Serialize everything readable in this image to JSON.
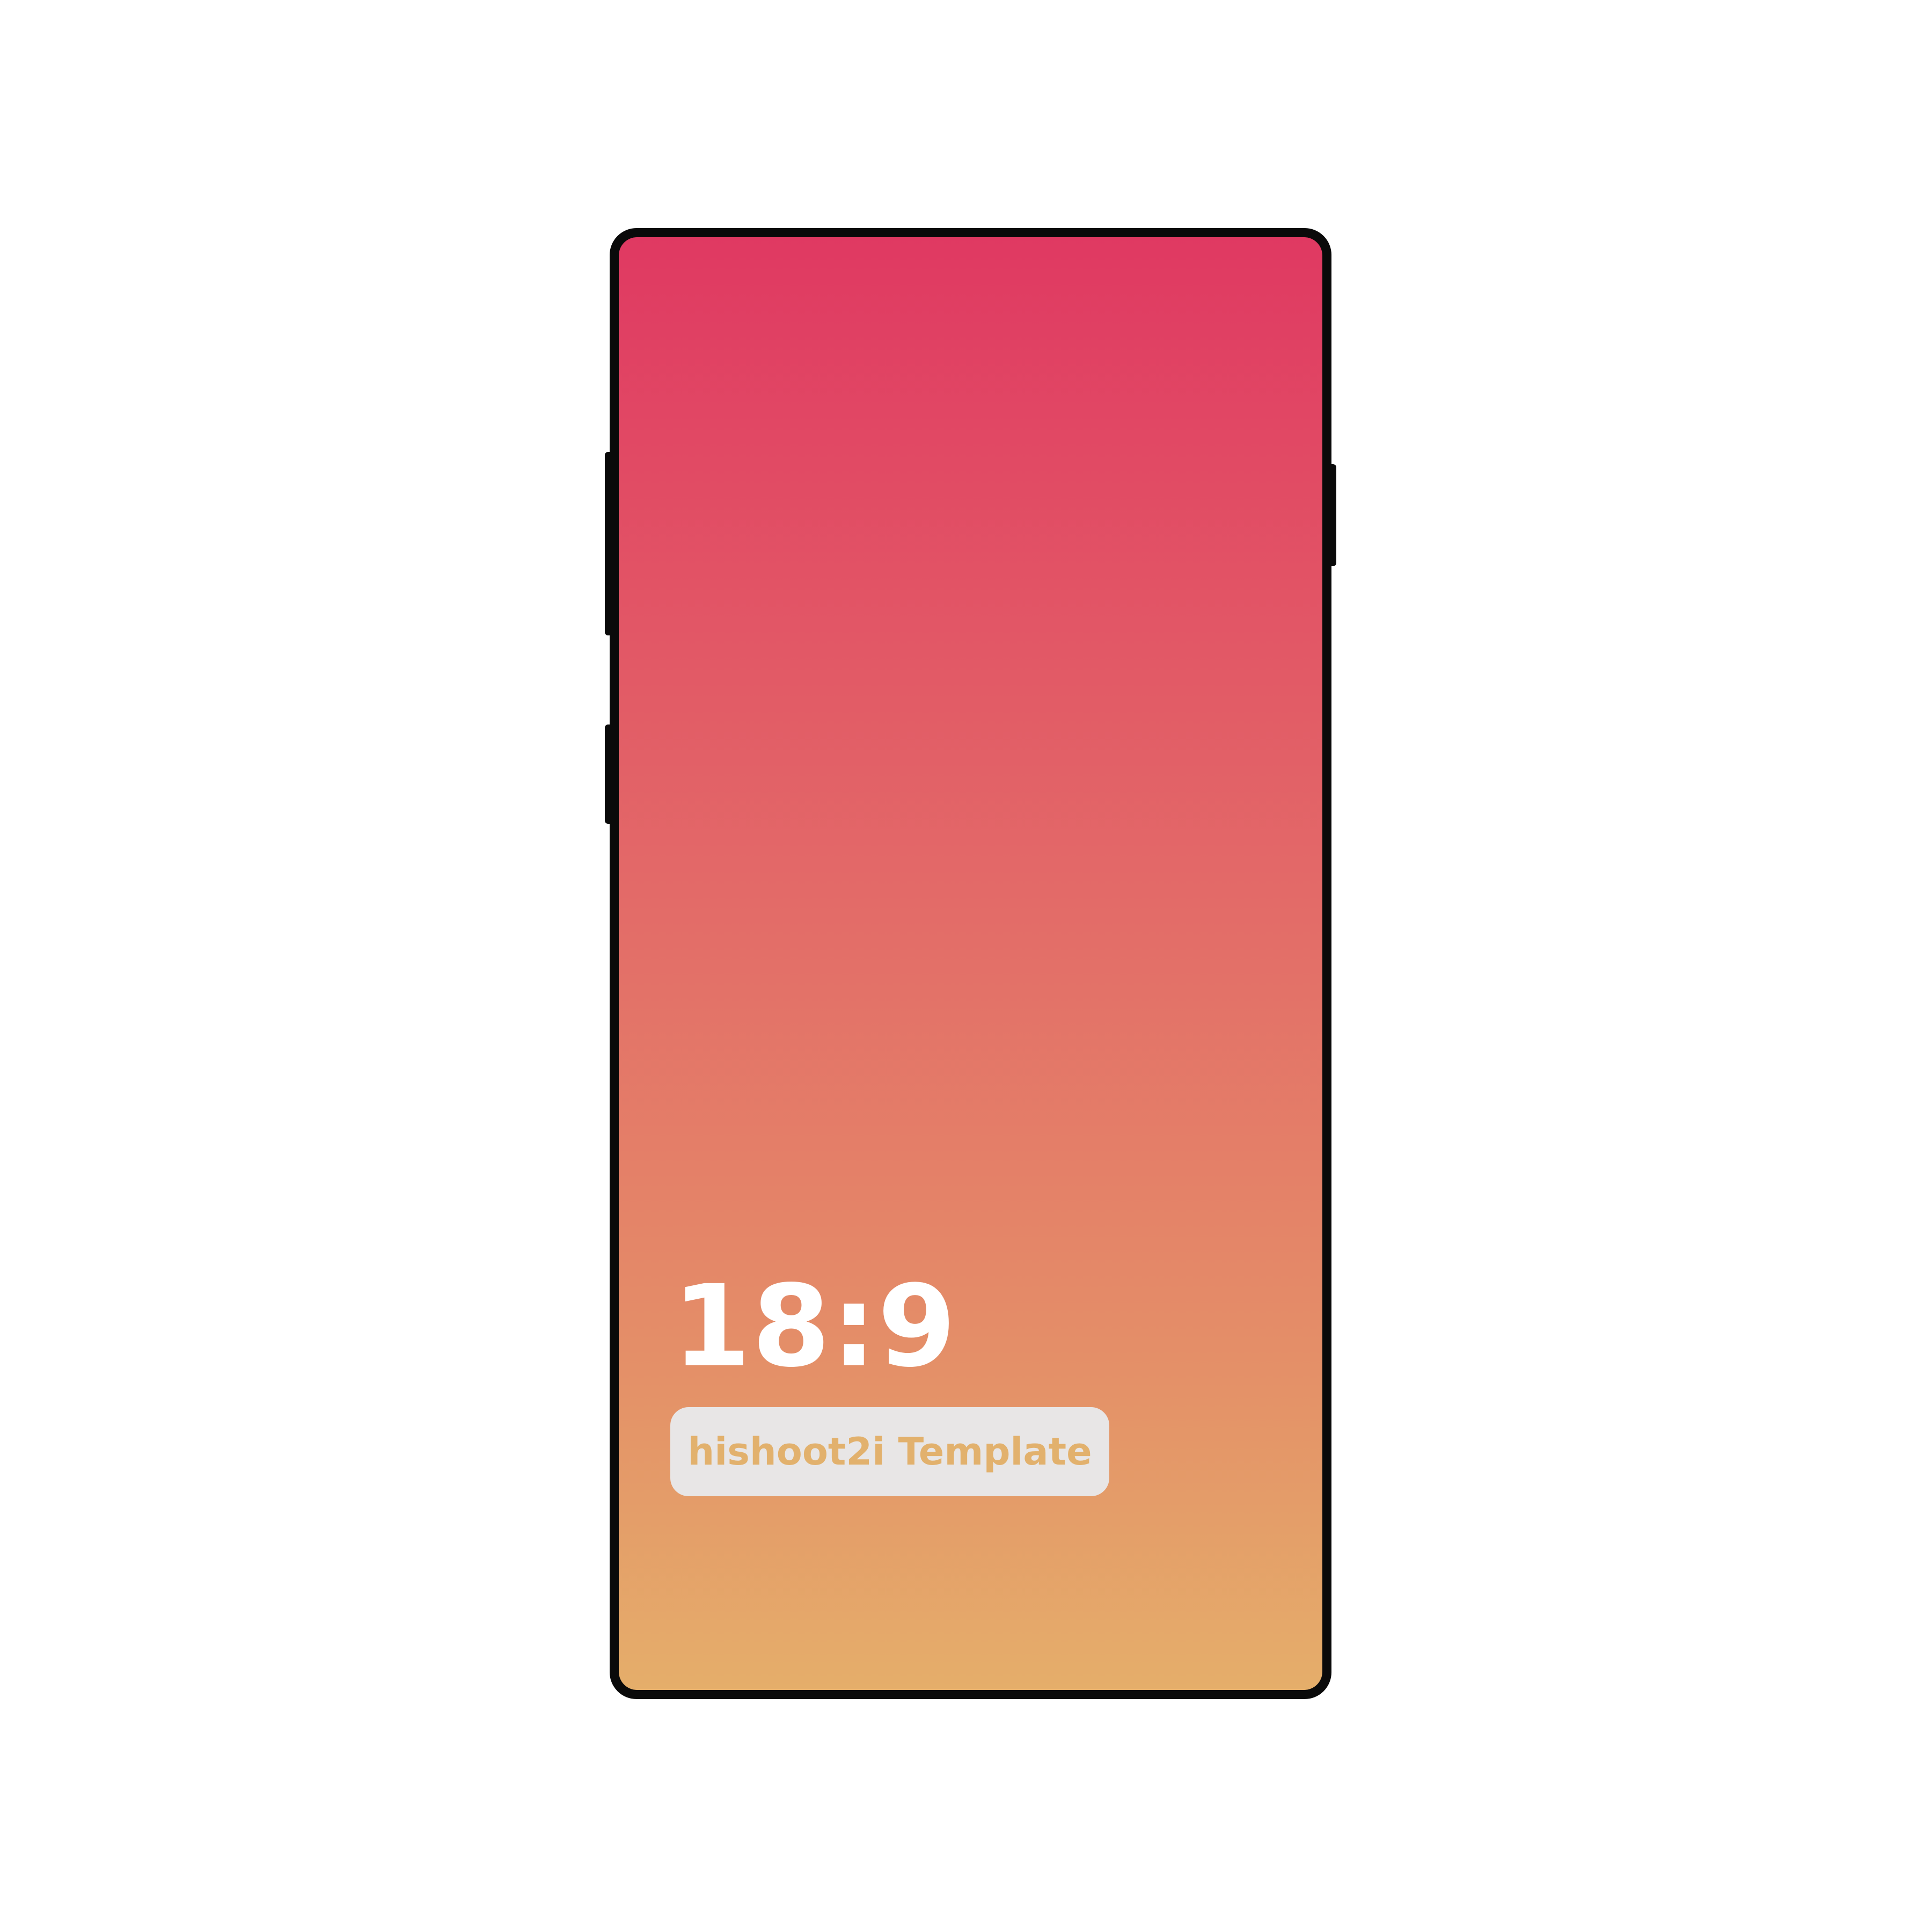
{
  "mockup": {
    "ratio_label": "18:9",
    "template_label": "hishoot2i Template"
  },
  "colors": {
    "background": "#ffffff",
    "frame": "#0a0a0a",
    "gradient_top": "#e03962",
    "gradient_bottom": "#e5ae6a",
    "badge_bg": "#e8e6e6",
    "badge_text": "#e2b16d",
    "ratio_text": "#ffffff"
  }
}
